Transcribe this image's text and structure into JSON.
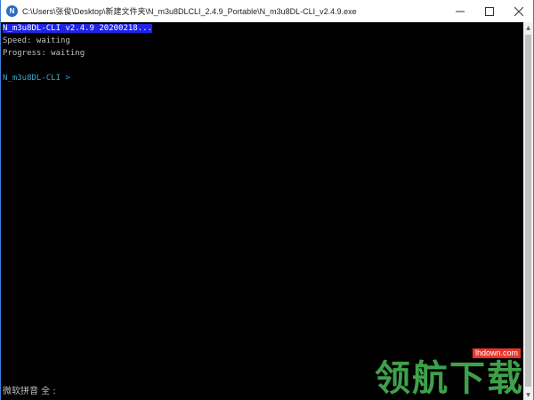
{
  "window": {
    "icon_letter": "N",
    "title": "C:\\Users\\张俊\\Desktop\\新建文件夹\\N_m3u8DLCLI_2.4.9_Portable\\N_m3u8DL-CLI_v2.4.9.exe"
  },
  "console": {
    "header_line": "N_m3u8DL-CLI v2.4.9 20200218...",
    "speed_line": "Speed: waiting",
    "progress_line": "Progress: waiting",
    "prompt_line": "N_m3u8DL-CLI >",
    "ime_status": "微软拼音 全 :"
  },
  "watermark": {
    "url": "lhdown.com",
    "text": "领航下载"
  },
  "colors": {
    "console_bg": "#000000",
    "console_text": "#c0c0c0",
    "header_highlight": "#1e24e6",
    "prompt": "#3fa7c9",
    "watermark_green": "#3ea14a",
    "watermark_red": "#e8352b"
  },
  "icons": [
    "minimize-icon",
    "maximize-icon",
    "close-icon",
    "scroll-up-icon",
    "scroll-down-icon"
  ]
}
